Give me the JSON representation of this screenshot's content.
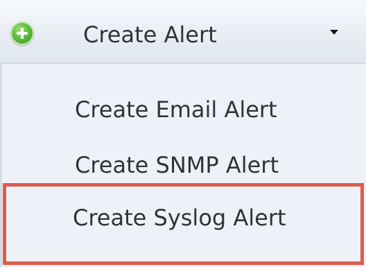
{
  "dropdown": {
    "title": "Create Alert",
    "icon": "plus-circle-icon",
    "caret_icon": "chevron-down-icon"
  },
  "menu": {
    "items": [
      {
        "label": "Create Email Alert"
      },
      {
        "label": "Create SNMP Alert"
      },
      {
        "label": "Create Syslog Alert",
        "highlighted": true
      }
    ]
  },
  "colors": {
    "highlight_border": "#e05a4e",
    "icon_green": "#5cb93a",
    "text": "#333333",
    "menu_background": "#eef2f8"
  }
}
